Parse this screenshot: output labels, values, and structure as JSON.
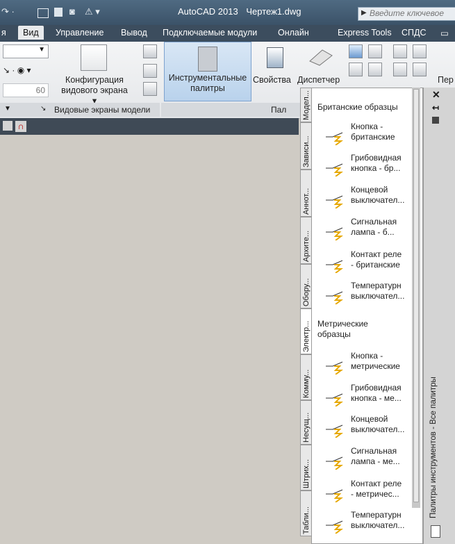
{
  "titlebar": {
    "app": "AutoCAD 2013",
    "file": "Чертеж1.dwg",
    "search_placeholder": "Введите ключевое"
  },
  "tabs": [
    "я",
    "Вид",
    "Управление",
    "Вывод",
    "Подключаемые модули",
    "Онлайн",
    "Express Tools",
    "СПДС"
  ],
  "ribbon": {
    "viewport_config": [
      "Конфигурация",
      "видового экрана ▾"
    ],
    "tool_palettes": [
      "Инструментальные",
      "палитры"
    ],
    "properties": "Свойства",
    "dispatcher": "Диспетчер",
    "per": "Пер",
    "num60": "60",
    "panel_viewports": "Видовые экраны модели",
    "panel_palettes": "Пал"
  },
  "palette": {
    "tabs": [
      "Модел...",
      "Зависи...",
      "Аннот...",
      "Архите...",
      "Обору...",
      "Электр...",
      "Комму...",
      "Несущ...",
      "Штрих...",
      "Табли..."
    ],
    "active_tab": "Электр...",
    "sections": [
      {
        "title": "Британские образцы",
        "items": [
          [
            "Кнопка -",
            "британские"
          ],
          [
            "Грибовидная",
            "кнопка - бр..."
          ],
          [
            "Концевой",
            "выключател..."
          ],
          [
            "Сигнальная",
            "лампа - б..."
          ],
          [
            "Контакт реле",
            "- британские"
          ],
          [
            "Температурн",
            "выключател..."
          ]
        ]
      },
      {
        "title": [
          "Метрические",
          "образцы"
        ],
        "items": [
          [
            "Кнопка -",
            "метрические"
          ],
          [
            "Грибовидная",
            "кнопка - ме..."
          ],
          [
            "Концевой",
            "выключател..."
          ],
          [
            "Сигнальная",
            "лампа - ме..."
          ],
          [
            "Контакт реле",
            "- метричес..."
          ],
          [
            "Температурн",
            "выключател..."
          ]
        ]
      }
    ],
    "vertical_title": "Палитры инструментов - Все палитры",
    "icons": [
      "close-icon",
      "auto-hide-icon",
      "properties-icon"
    ]
  }
}
